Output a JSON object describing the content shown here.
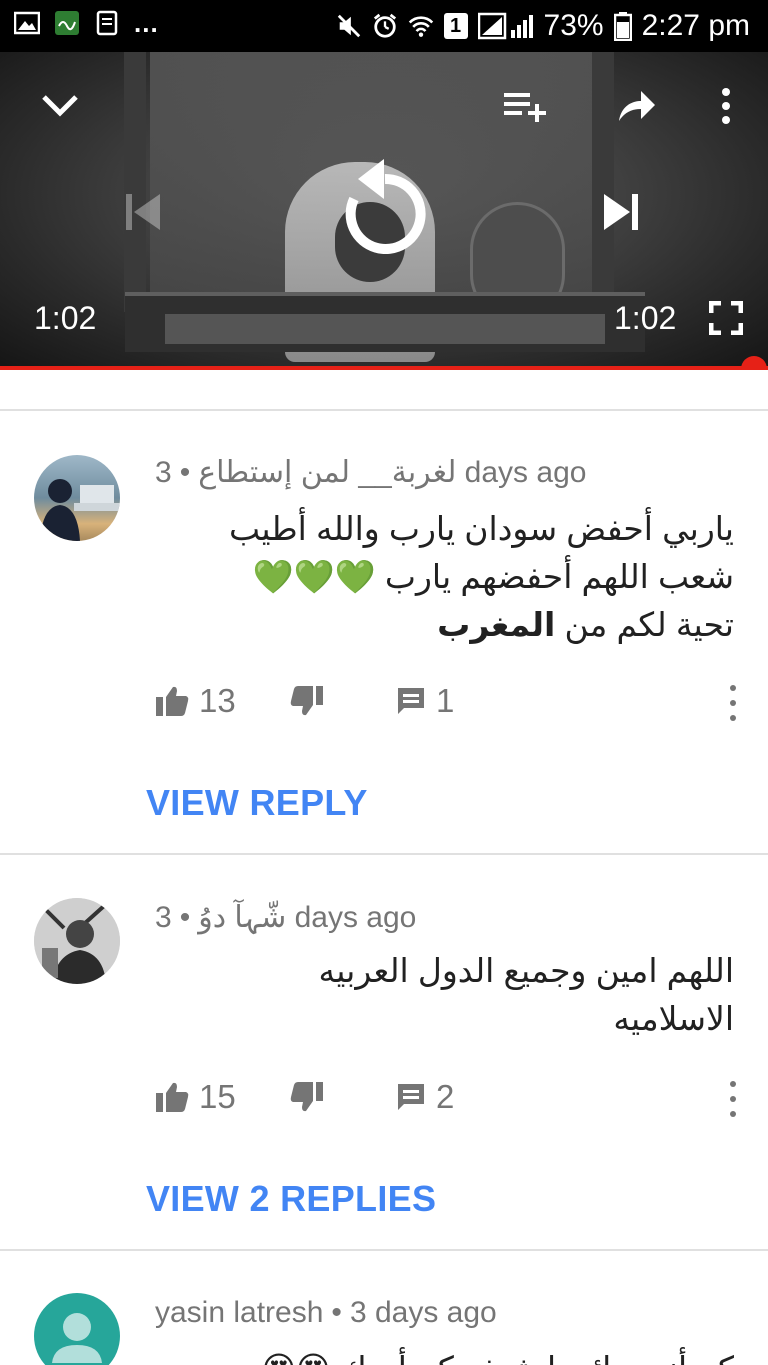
{
  "status_bar": {
    "battery_percent": "73%",
    "time": "2:27 pm",
    "sim_badge": "1",
    "more": "...",
    "left_icons": [
      "gallery-icon",
      "calligraphy-app-icon",
      "notes-icon"
    ],
    "right_icons": [
      "mute-icon",
      "alarm-icon",
      "wifi-icon",
      "sim1-icon",
      "signal-icon",
      "battery-icon"
    ]
  },
  "player": {
    "current_time": "1:02",
    "duration": "1:02",
    "progress": 1.0,
    "accent_color": "#e62117"
  },
  "comments": [
    {
      "author": "لغربة__ لمن إستطاع",
      "time_ago": "3 days ago",
      "lines": [
        "ياربي أحفض سودان يارب والله أطيب",
        "شعب اللهم أحفضهم يارب 💚💚💚",
        "تحية لكم من"
      ],
      "bold_word": "المغرب",
      "likes": "13",
      "replies": "1",
      "view_replies_label": "VIEW REPLY"
    },
    {
      "author": "شّہآ دوُ",
      "time_ago": "3 days ago",
      "lines": [
        "اللهم امين وجميع الدول العربيه",
        "الاسلاميه"
      ],
      "likes": "15",
      "replies": "2",
      "view_replies_label": "VIEW 2 REPLIES"
    },
    {
      "author": "yasin latresh",
      "time_ago": "3 days ago",
      "lines": [
        "كم أنت رائع يا شيخ وكم أحبك 😍😍"
      ]
    }
  ],
  "colors": {
    "link": "#4285f4",
    "meta_text": "#757575",
    "body_text": "#212121"
  }
}
